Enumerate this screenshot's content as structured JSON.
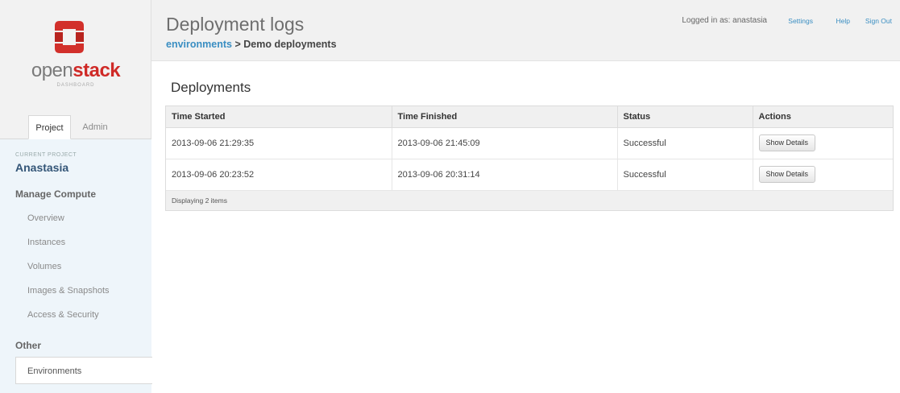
{
  "branding": {
    "logo_word_open": "open",
    "logo_word_stack": "stack",
    "logo_subtitle": "DASHBOARD",
    "logo_color": "#cf2a27"
  },
  "sidebar": {
    "tabs": [
      {
        "label": "Project",
        "active": true
      },
      {
        "label": "Admin",
        "active": false
      }
    ],
    "current_project_label": "CURRENT PROJECT",
    "current_project_name": "Anastasia",
    "section_manage": "Manage Compute",
    "items": [
      {
        "label": "Overview"
      },
      {
        "label": "Instances"
      },
      {
        "label": "Volumes"
      },
      {
        "label": "Images & Snapshots"
      },
      {
        "label": "Access & Security"
      }
    ],
    "section_other": "Other",
    "selected_item": "Environments"
  },
  "header": {
    "title": "Deployment logs",
    "breadcrumb_link": "environments",
    "breadcrumb_separator": ">",
    "breadcrumb_current": "Demo deployments",
    "logged_in_text": "Logged in as: anastasia",
    "settings_label": "Settings",
    "help_label": "Help",
    "signout_label": "Sign Out"
  },
  "main": {
    "section_title": "Deployments",
    "columns": [
      "Time Started",
      "Time Finished",
      "Status",
      "Actions"
    ],
    "rows": [
      {
        "started": "2013-09-06 21:29:35",
        "finished": "2013-09-06 21:45:09",
        "status": "Successful",
        "action": "Show Details"
      },
      {
        "started": "2013-09-06 20:23:52",
        "finished": "2013-09-06 20:31:14",
        "status": "Successful",
        "action": "Show Details"
      }
    ],
    "footer_text": "Displaying 2 items"
  },
  "colors": {
    "link": "#3a8ec2",
    "project_panel_bg": "#eef5fa"
  }
}
